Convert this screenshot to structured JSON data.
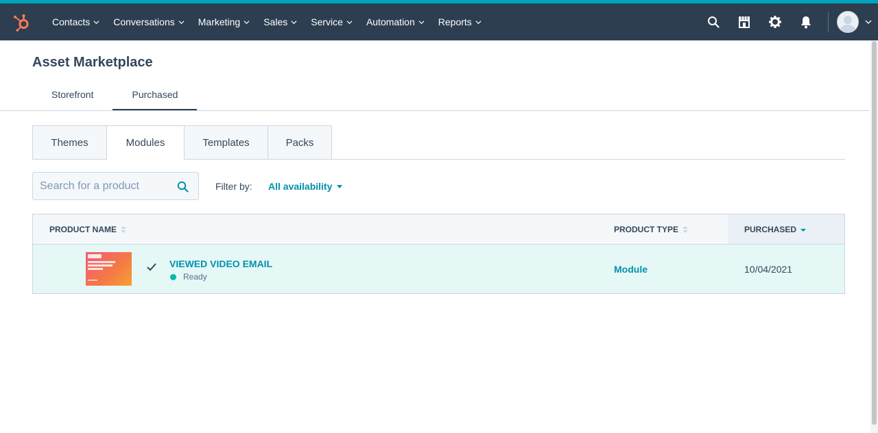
{
  "nav": {
    "items": [
      {
        "label": "Contacts"
      },
      {
        "label": "Conversations"
      },
      {
        "label": "Marketing"
      },
      {
        "label": "Sales"
      },
      {
        "label": "Service"
      },
      {
        "label": "Automation"
      },
      {
        "label": "Reports"
      }
    ],
    "icons": [
      "search-icon",
      "marketplace-icon",
      "gear-icon",
      "bell-icon"
    ],
    "accent_color": "#00a4bd",
    "background_color": "#2d3e50",
    "logo_color": "#ff7a59"
  },
  "page": {
    "title": "Asset Marketplace",
    "tabs": [
      {
        "label": "Storefront",
        "active": false
      },
      {
        "label": "Purchased",
        "active": true
      }
    ]
  },
  "sub_tabs": [
    {
      "label": "Themes",
      "active": false
    },
    {
      "label": "Modules",
      "active": true
    },
    {
      "label": "Templates",
      "active": false
    },
    {
      "label": "Packs",
      "active": false
    }
  ],
  "search": {
    "placeholder": "Search for a product",
    "value": ""
  },
  "filter": {
    "label": "Filter by:",
    "value": "All availability"
  },
  "table": {
    "columns": [
      {
        "label": "PRODUCT NAME",
        "sort": "none"
      },
      {
        "label": "PRODUCT TYPE",
        "sort": "none"
      },
      {
        "label": "PURCHASED",
        "sort": "descending"
      }
    ],
    "rows": [
      {
        "name": "VIEWED VIDEO EMAIL",
        "status": "Ready",
        "status_color": "#00bda5",
        "type": "Module",
        "purchased": "10/04/2021",
        "selected": true
      }
    ]
  }
}
